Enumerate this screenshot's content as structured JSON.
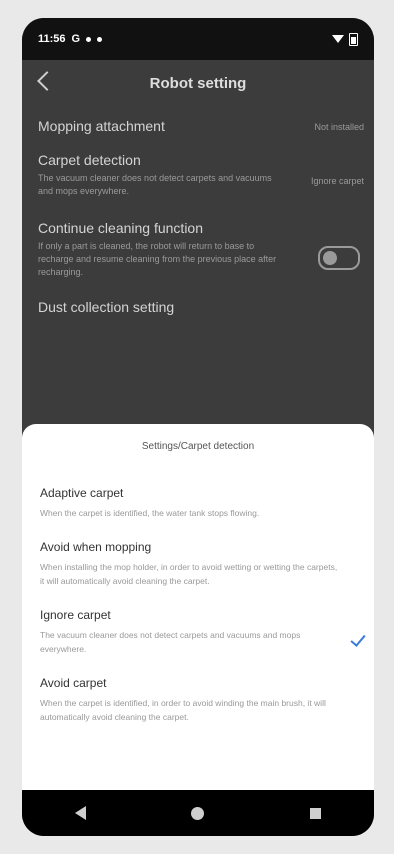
{
  "status": {
    "time": "11:56",
    "indicators": "G"
  },
  "page": {
    "title": "Robot setting",
    "rows": [
      {
        "label": "Mopping attachment",
        "desc": "",
        "value": "Not installed"
      },
      {
        "label": "Carpet detection",
        "desc": "The vacuum cleaner does not detect carpets and vacuums and mops everywhere.",
        "value": "Ignore carpet"
      },
      {
        "label": "Continue cleaning function",
        "desc": "If only a part is cleaned, the robot will return to base to recharge and resume cleaning from the previous place after recharging.",
        "value": ""
      },
      {
        "label": "Dust collection setting",
        "desc": "",
        "value": ""
      }
    ]
  },
  "sheet": {
    "title": "Settings/Carpet detection",
    "options": [
      {
        "name": "Adaptive carpet",
        "desc": "When the carpet is identified, the water tank stops flowing.",
        "selected": false
      },
      {
        "name": "Avoid when mopping",
        "desc": "When installing the mop holder, in order to avoid wetting or wetting the carpets, it will automatically avoid cleaning the carpet.",
        "selected": false
      },
      {
        "name": "Ignore carpet",
        "desc": "The vacuum cleaner does not detect carpets and vacuums and mops everywhere.",
        "selected": true
      },
      {
        "name": "Avoid carpet",
        "desc": "When the carpet is identified, in order to avoid winding the main brush, it will automatically avoid cleaning the carpet.",
        "selected": false
      }
    ]
  },
  "colors": {
    "accent": "#3a7bd5"
  },
  "icons": {
    "back": "chevron-left-icon",
    "check": "check-icon",
    "nav_back": "nav-back-icon",
    "nav_home": "nav-home-icon",
    "nav_recents": "nav-recents-icon"
  }
}
